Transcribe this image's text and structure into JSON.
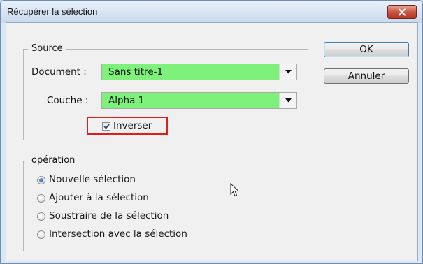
{
  "window": {
    "title": "Récupérer la sélection"
  },
  "source": {
    "legend": "Source",
    "document_label": "Document :",
    "document_value": "Sans titre-1",
    "couche_label": "Couche :",
    "couche_value": "Alpha 1",
    "invert_label": "Inverser",
    "invert_checked": true
  },
  "operation": {
    "legend": "opération",
    "options": [
      {
        "label": "Nouvelle sélection",
        "checked": true
      },
      {
        "label": "Ajouter à la sélection",
        "checked": false
      },
      {
        "label": "Soustraire de la sélection",
        "checked": false
      },
      {
        "label": "Intersection avec la sélection",
        "checked": false
      }
    ]
  },
  "buttons": {
    "ok": "OK",
    "cancel": "Annuler"
  },
  "colors": {
    "highlight_box": "#e01c1c",
    "select_fill": "#7ef17b"
  }
}
